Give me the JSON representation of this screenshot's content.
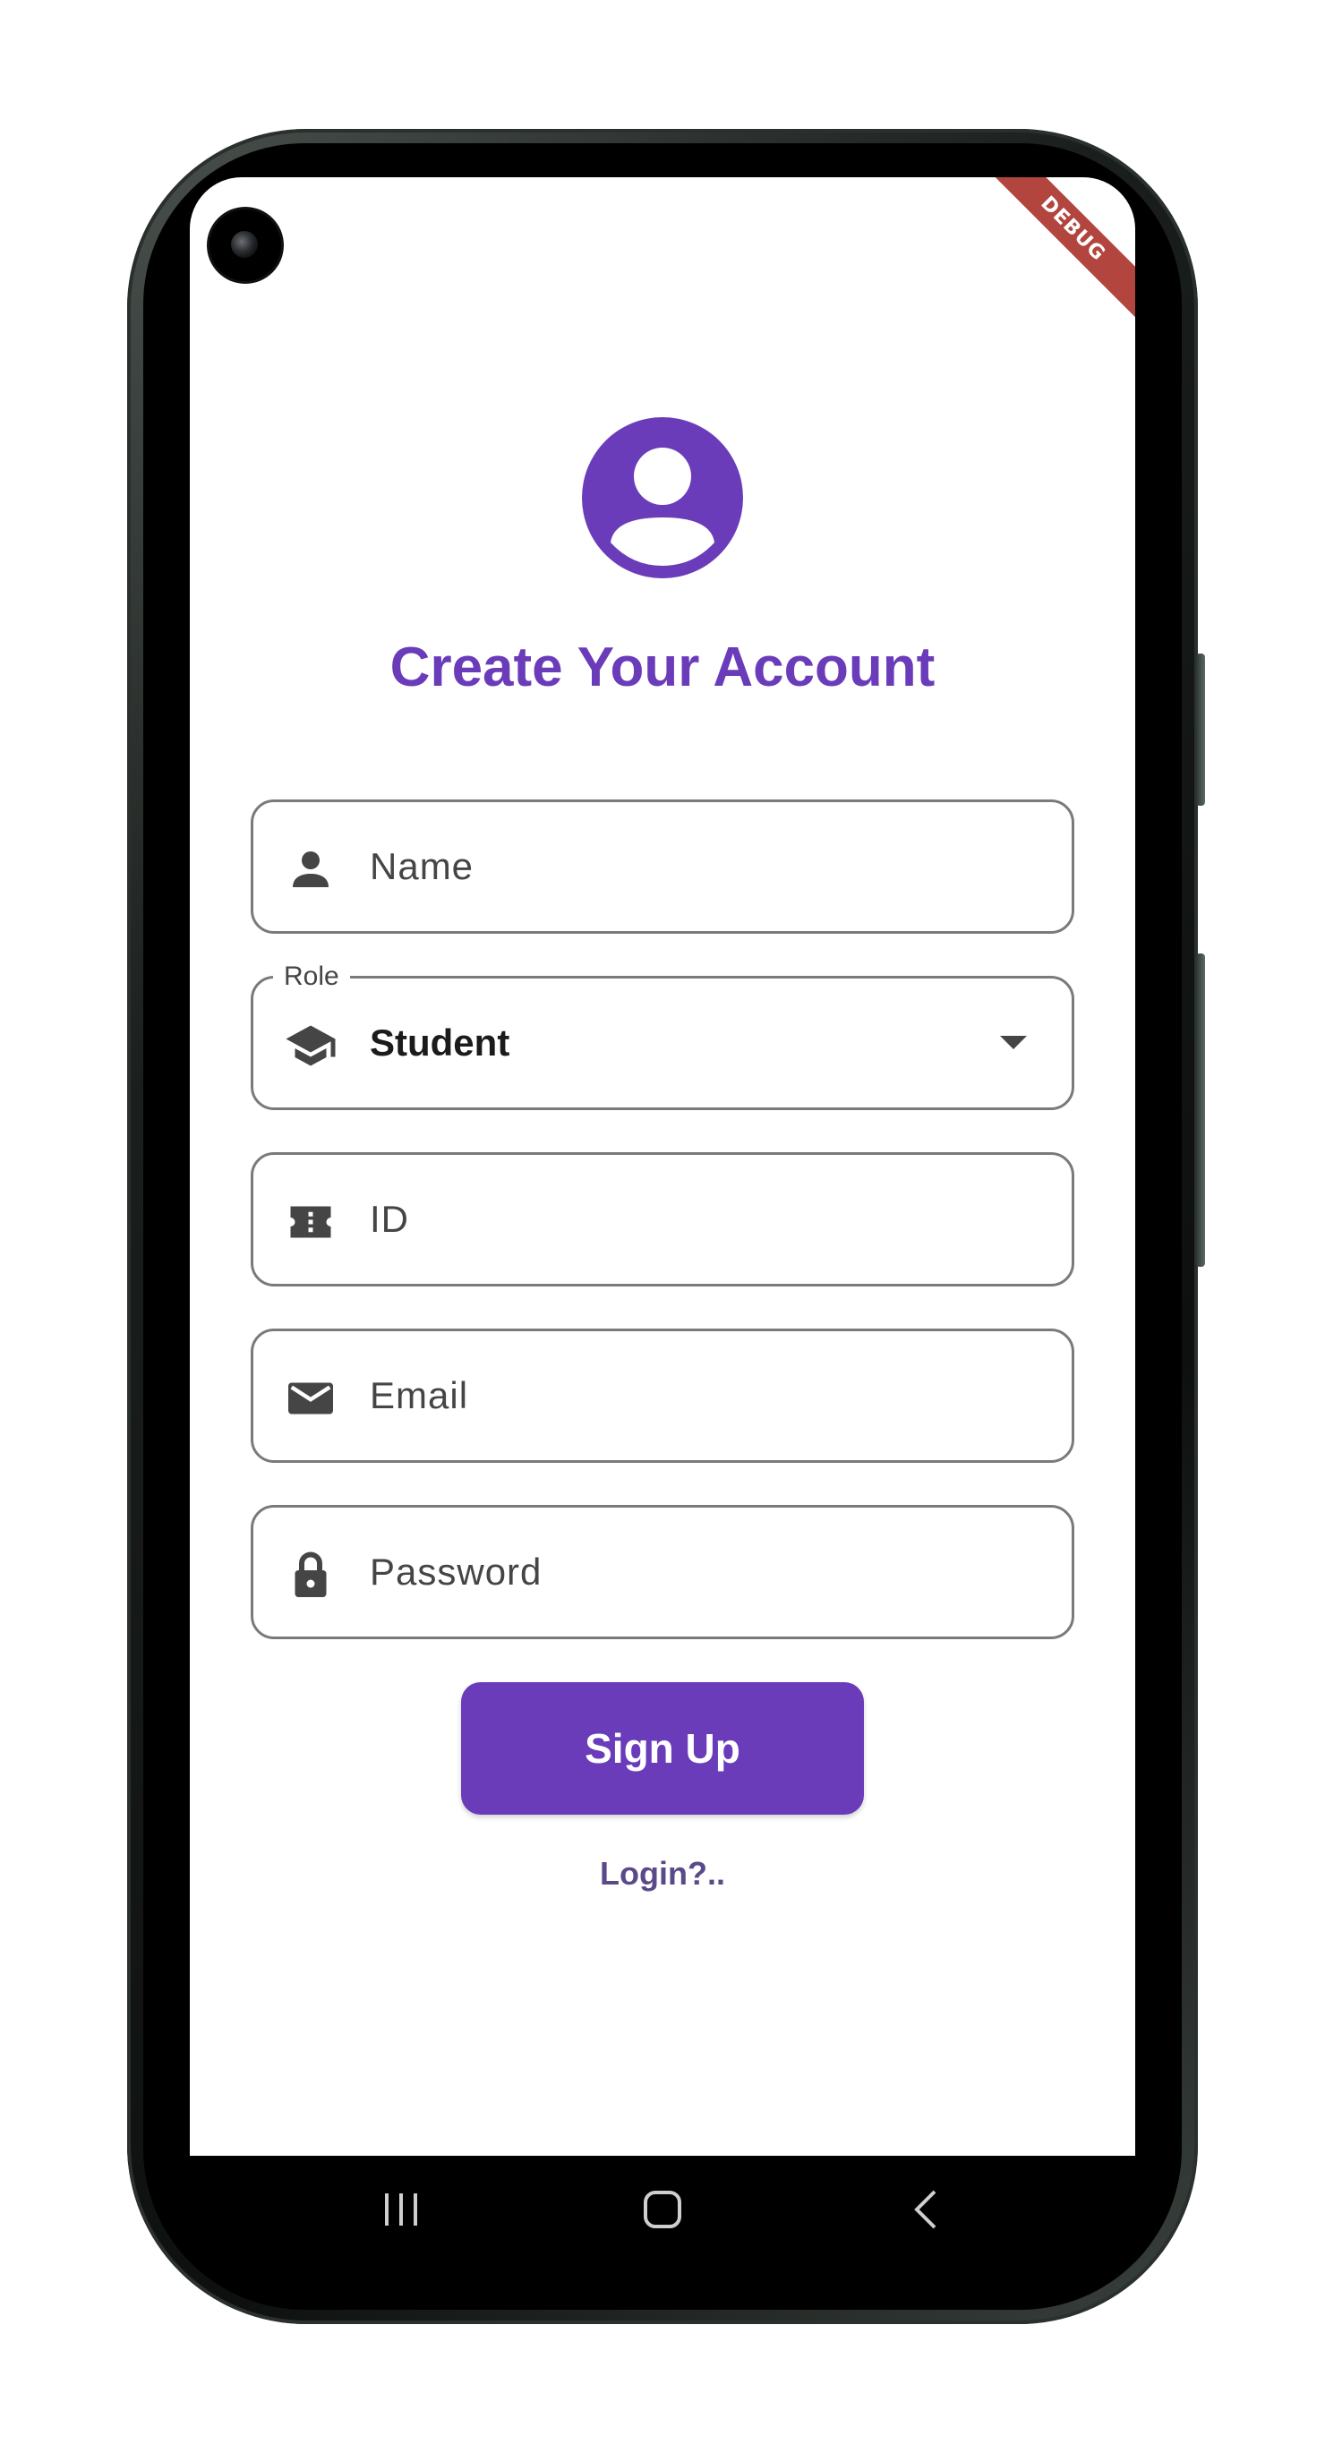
{
  "debug_banner": "DEBUG",
  "header": {
    "title": "Create Your Account",
    "avatar_icon": "account-circle-icon"
  },
  "form": {
    "name": {
      "placeholder": "Name",
      "icon": "person-icon"
    },
    "role": {
      "label": "Role",
      "value": "Student",
      "icon": "graduation-cap-icon"
    },
    "id": {
      "placeholder": "ID",
      "icon": "ticket-icon"
    },
    "email": {
      "placeholder": "Email",
      "icon": "mail-icon"
    },
    "password": {
      "placeholder": "Password",
      "icon": "lock-icon"
    }
  },
  "actions": {
    "signup_label": "Sign Up",
    "login_label": "Login?.."
  },
  "colors": {
    "accent": "#6a3cba",
    "icon": "#454545",
    "outline": "#7a7a7a"
  },
  "navbar": {
    "recent_icon": "recent-apps-icon",
    "home_icon": "home-icon",
    "back_icon": "back-icon"
  }
}
